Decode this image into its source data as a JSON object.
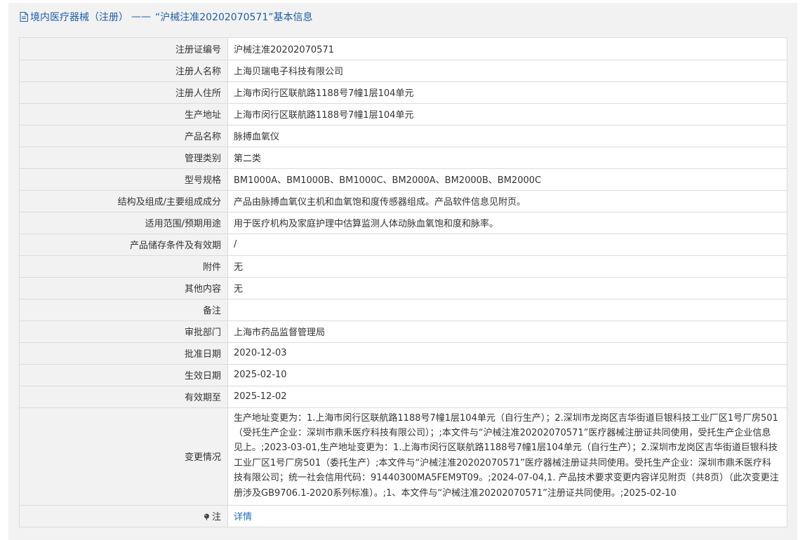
{
  "header": {
    "category": "境内医疗器械（注册）",
    "separator": "——",
    "subject": "“沪械注准20202070571”",
    "suffix": "基本信息"
  },
  "fields": [
    {
      "label": "注册证编号",
      "value": "沪械注准20202070571"
    },
    {
      "label": "注册人名称",
      "value": "上海贝瑞电子科技有限公司"
    },
    {
      "label": "注册人住所",
      "value": "上海市闵行区联航路1188号7幢1层104单元"
    },
    {
      "label": "生产地址",
      "value": "上海市闵行区联航路1188号7幢1层104单元"
    },
    {
      "label": "产品名称",
      "value": "脉搏血氧仪"
    },
    {
      "label": "管理类别",
      "value": "第二类"
    },
    {
      "label": "型号规格",
      "value": "BM1000A、BM1000B、BM1000C、BM2000A、BM2000B、BM2000C"
    },
    {
      "label": "结构及组成/主要组成成分",
      "value": "产品由脉搏血氧仪主机和血氧饱和度传感器组成。产品软件信息见附页。"
    },
    {
      "label": "适用范围/预期用途",
      "value": "用于医疗机构及家庭护理中估算监测人体动脉血氧饱和度和脉率。"
    },
    {
      "label": "产品储存条件及有效期",
      "value": "/"
    },
    {
      "label": "附件",
      "value": "无"
    },
    {
      "label": "其他内容",
      "value": "无"
    },
    {
      "label": "备注",
      "value": ""
    },
    {
      "label": "审批部门",
      "value": "上海市药品监督管理局"
    },
    {
      "label": "批准日期",
      "value": "2020-12-03"
    },
    {
      "label": "生效日期",
      "value": "2025-02-10"
    },
    {
      "label": "有效期至",
      "value": "2025-12-02"
    }
  ],
  "change": {
    "label": "变更情况",
    "value": "生产地址变更为：1.上海市闵行区联航路1188号7幢1层104单元（自行生产）；2.深圳市龙岗区吉华街道巨银科技工业厂区1号厂房501（受托生产企业：深圳市鼎禾医疗科技有限公司）；;本文件与“沪械注准20202070571”医疗器械注册证共同使用，受托生产企业信息见上。;2023-03-01,生产地址变更为：1.上海市闵行区联航路1188号7幢1层104单元（自行生产）；2.深圳市龙岗区吉华街道巨银科技工业厂区1号厂房501（委托生产）;本文件与“沪械注准20202070571”医疗器械注册证共同使用。受托生产企业：深圳市鼎禾医疗科技有限公司；统一社会信用代码：91440300MA5FEM9T09。;2024-07-04,1. 产品技术要求变更内容详见附页（共8页）（此次变更注册涉及GB9706.1-2020系列标准）。;1、本文件与“沪械注准20202070571”注册证共同使用。;2025-02-10"
  },
  "note": {
    "label": "注",
    "link": "详情",
    "icon": "pin-icon"
  },
  "colors": {
    "title": "#1c5ea8",
    "link": "#1a6fc0",
    "label_bg": "#f2f2f2",
    "border": "#dcdcdc"
  }
}
